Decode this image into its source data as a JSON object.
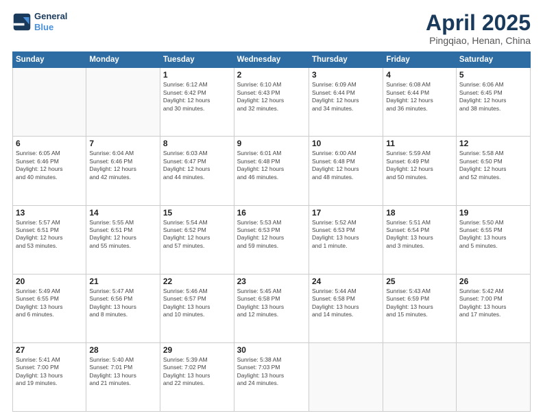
{
  "header": {
    "logo_line1": "General",
    "logo_line2": "Blue",
    "month": "April 2025",
    "location": "Pingqiao, Henan, China"
  },
  "weekdays": [
    "Sunday",
    "Monday",
    "Tuesday",
    "Wednesday",
    "Thursday",
    "Friday",
    "Saturday"
  ],
  "weeks": [
    [
      {
        "day": "",
        "info": ""
      },
      {
        "day": "",
        "info": ""
      },
      {
        "day": "1",
        "info": "Sunrise: 6:12 AM\nSunset: 6:42 PM\nDaylight: 12 hours\nand 30 minutes."
      },
      {
        "day": "2",
        "info": "Sunrise: 6:10 AM\nSunset: 6:43 PM\nDaylight: 12 hours\nand 32 minutes."
      },
      {
        "day": "3",
        "info": "Sunrise: 6:09 AM\nSunset: 6:44 PM\nDaylight: 12 hours\nand 34 minutes."
      },
      {
        "day": "4",
        "info": "Sunrise: 6:08 AM\nSunset: 6:44 PM\nDaylight: 12 hours\nand 36 minutes."
      },
      {
        "day": "5",
        "info": "Sunrise: 6:06 AM\nSunset: 6:45 PM\nDaylight: 12 hours\nand 38 minutes."
      }
    ],
    [
      {
        "day": "6",
        "info": "Sunrise: 6:05 AM\nSunset: 6:46 PM\nDaylight: 12 hours\nand 40 minutes."
      },
      {
        "day": "7",
        "info": "Sunrise: 6:04 AM\nSunset: 6:46 PM\nDaylight: 12 hours\nand 42 minutes."
      },
      {
        "day": "8",
        "info": "Sunrise: 6:03 AM\nSunset: 6:47 PM\nDaylight: 12 hours\nand 44 minutes."
      },
      {
        "day": "9",
        "info": "Sunrise: 6:01 AM\nSunset: 6:48 PM\nDaylight: 12 hours\nand 46 minutes."
      },
      {
        "day": "10",
        "info": "Sunrise: 6:00 AM\nSunset: 6:48 PM\nDaylight: 12 hours\nand 48 minutes."
      },
      {
        "day": "11",
        "info": "Sunrise: 5:59 AM\nSunset: 6:49 PM\nDaylight: 12 hours\nand 50 minutes."
      },
      {
        "day": "12",
        "info": "Sunrise: 5:58 AM\nSunset: 6:50 PM\nDaylight: 12 hours\nand 52 minutes."
      }
    ],
    [
      {
        "day": "13",
        "info": "Sunrise: 5:57 AM\nSunset: 6:51 PM\nDaylight: 12 hours\nand 53 minutes."
      },
      {
        "day": "14",
        "info": "Sunrise: 5:55 AM\nSunset: 6:51 PM\nDaylight: 12 hours\nand 55 minutes."
      },
      {
        "day": "15",
        "info": "Sunrise: 5:54 AM\nSunset: 6:52 PM\nDaylight: 12 hours\nand 57 minutes."
      },
      {
        "day": "16",
        "info": "Sunrise: 5:53 AM\nSunset: 6:53 PM\nDaylight: 12 hours\nand 59 minutes."
      },
      {
        "day": "17",
        "info": "Sunrise: 5:52 AM\nSunset: 6:53 PM\nDaylight: 13 hours\nand 1 minute."
      },
      {
        "day": "18",
        "info": "Sunrise: 5:51 AM\nSunset: 6:54 PM\nDaylight: 13 hours\nand 3 minutes."
      },
      {
        "day": "19",
        "info": "Sunrise: 5:50 AM\nSunset: 6:55 PM\nDaylight: 13 hours\nand 5 minutes."
      }
    ],
    [
      {
        "day": "20",
        "info": "Sunrise: 5:49 AM\nSunset: 6:55 PM\nDaylight: 13 hours\nand 6 minutes."
      },
      {
        "day": "21",
        "info": "Sunrise: 5:47 AM\nSunset: 6:56 PM\nDaylight: 13 hours\nand 8 minutes."
      },
      {
        "day": "22",
        "info": "Sunrise: 5:46 AM\nSunset: 6:57 PM\nDaylight: 13 hours\nand 10 minutes."
      },
      {
        "day": "23",
        "info": "Sunrise: 5:45 AM\nSunset: 6:58 PM\nDaylight: 13 hours\nand 12 minutes."
      },
      {
        "day": "24",
        "info": "Sunrise: 5:44 AM\nSunset: 6:58 PM\nDaylight: 13 hours\nand 14 minutes."
      },
      {
        "day": "25",
        "info": "Sunrise: 5:43 AM\nSunset: 6:59 PM\nDaylight: 13 hours\nand 15 minutes."
      },
      {
        "day": "26",
        "info": "Sunrise: 5:42 AM\nSunset: 7:00 PM\nDaylight: 13 hours\nand 17 minutes."
      }
    ],
    [
      {
        "day": "27",
        "info": "Sunrise: 5:41 AM\nSunset: 7:00 PM\nDaylight: 13 hours\nand 19 minutes."
      },
      {
        "day": "28",
        "info": "Sunrise: 5:40 AM\nSunset: 7:01 PM\nDaylight: 13 hours\nand 21 minutes."
      },
      {
        "day": "29",
        "info": "Sunrise: 5:39 AM\nSunset: 7:02 PM\nDaylight: 13 hours\nand 22 minutes."
      },
      {
        "day": "30",
        "info": "Sunrise: 5:38 AM\nSunset: 7:03 PM\nDaylight: 13 hours\nand 24 minutes."
      },
      {
        "day": "",
        "info": ""
      },
      {
        "day": "",
        "info": ""
      },
      {
        "day": "",
        "info": ""
      }
    ]
  ]
}
